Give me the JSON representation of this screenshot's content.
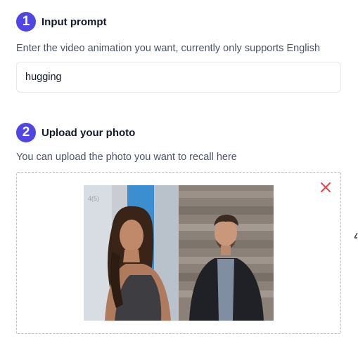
{
  "step1": {
    "number": "1",
    "title": "Input prompt",
    "description": "Enter the video animation you want, currently only supports English",
    "input_value": "hugging"
  },
  "step2": {
    "number": "2",
    "title": "Upload your photo",
    "description": "You can upload the photo you want to recall here"
  },
  "upload": {
    "remove_icon": "close-icon",
    "photo_subjects": [
      "woman",
      "man"
    ],
    "wall_number": "4(5)"
  },
  "colors": {
    "accent": "#4f46e5",
    "remove": "#ef4444",
    "border": "#e5e7eb"
  }
}
